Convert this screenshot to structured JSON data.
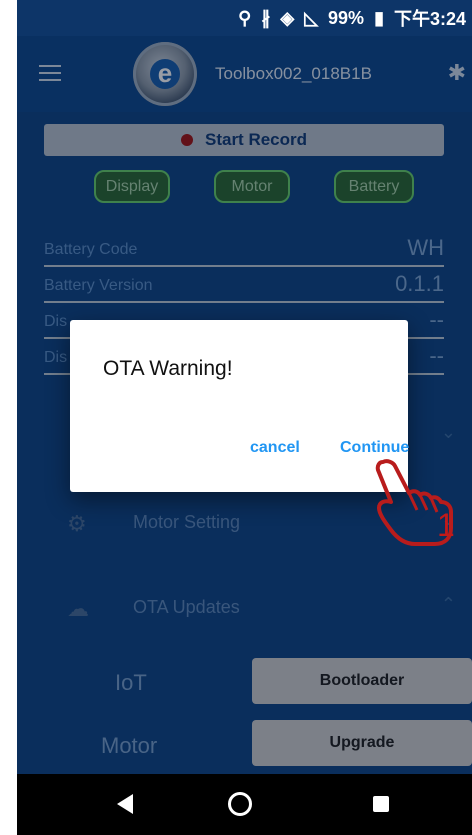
{
  "status_bar": {
    "battery_percent": "99%",
    "time": "下午3:24",
    "icons": [
      "location-icon",
      "bluetooth-icon",
      "wifi-icon",
      "no-signal-icon",
      "battery-icon"
    ]
  },
  "app_bar": {
    "device_name": "Toolbox002_018B1B",
    "logo_letter": "e"
  },
  "record": {
    "label": "Start Record"
  },
  "tabs": [
    {
      "label": "Display"
    },
    {
      "label": "Motor"
    },
    {
      "label": "Battery"
    }
  ],
  "info": [
    {
      "label": "Battery Code",
      "value": "WH"
    },
    {
      "label": "Battery Version",
      "value": "0.1.1"
    },
    {
      "label": "Dis",
      "value": "--"
    },
    {
      "label": "Dis",
      "value": "--"
    }
  ],
  "settings": [
    {
      "label": "Motor Setting",
      "icon": "gear-icon"
    },
    {
      "label": "OTA Updates",
      "icon": "cloud-download-icon"
    }
  ],
  "ota": {
    "rows": [
      {
        "label": "IoT",
        "button": "Bootloader"
      },
      {
        "label": "Motor",
        "button": "Upgrade"
      }
    ]
  },
  "dialog": {
    "title": "OTA Warning!",
    "cancel": "cancel",
    "continue": "Continue"
  },
  "annotation": {
    "step": "1"
  },
  "colors": {
    "background": "#114785",
    "accent": "#2196f3",
    "pill_border": "#6ad06c",
    "record_dot": "#a31616"
  }
}
